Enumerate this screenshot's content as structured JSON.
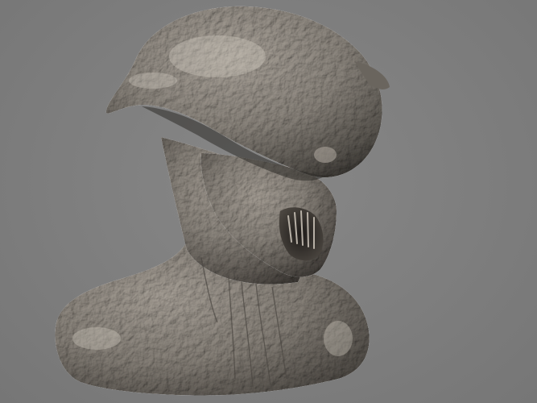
{
  "scene": {
    "subject": "creature-bust-sculpt",
    "background_color": "#7f7f7f",
    "material_color": "#8c867e",
    "highlight_color": "#cfc9bf",
    "shadow_color": "#2e2b28"
  }
}
